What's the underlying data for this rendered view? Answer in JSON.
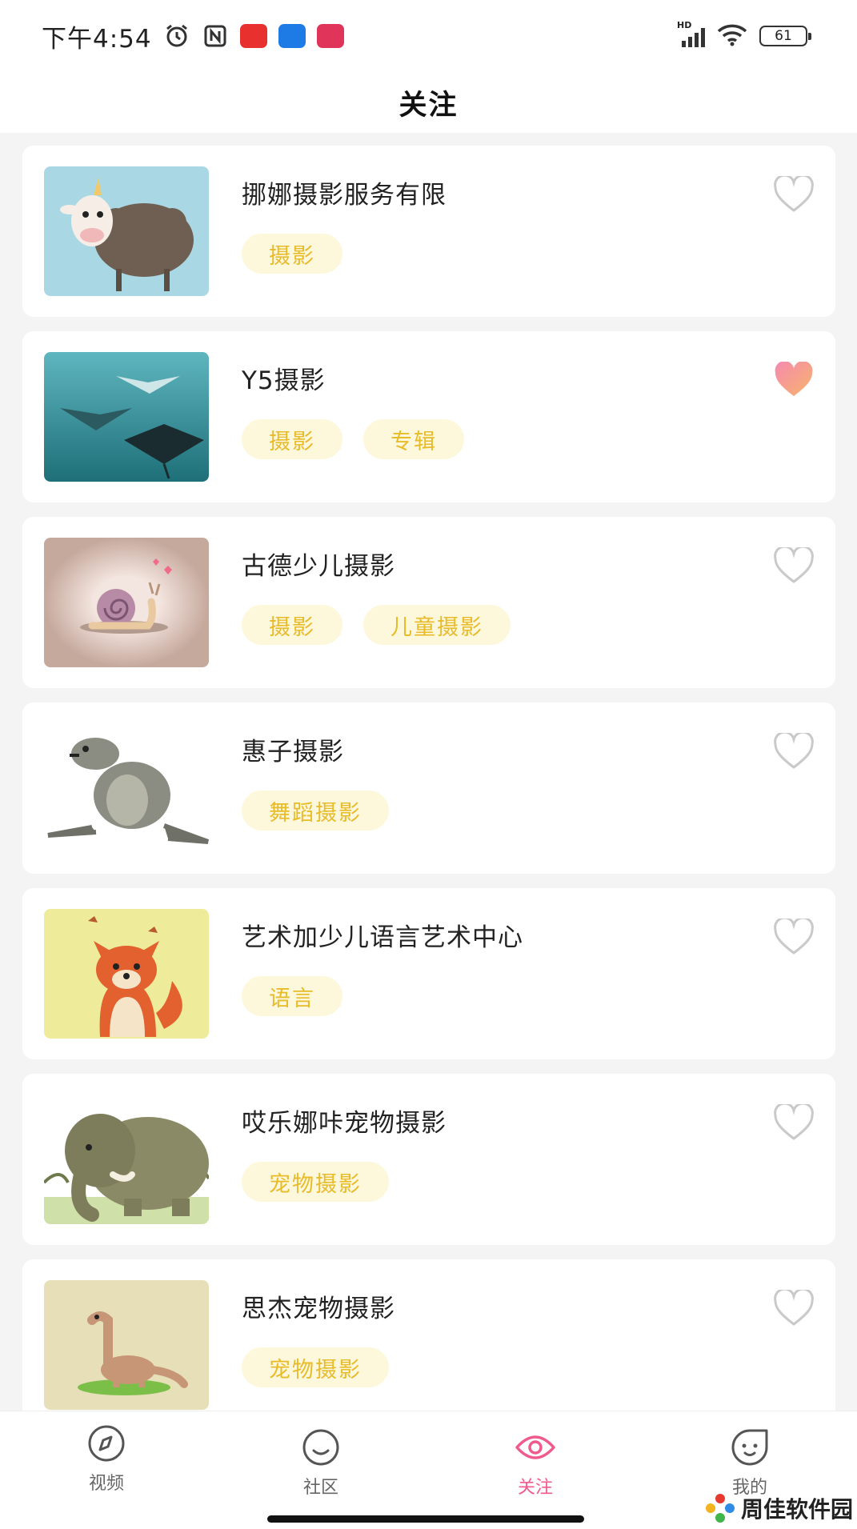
{
  "status": {
    "time": "下午4:54",
    "network": "HD",
    "battery": "61"
  },
  "header": {
    "title": "关注"
  },
  "items": [
    {
      "name": "挪娜摄影服务有限",
      "tags": [
        "摄影"
      ],
      "liked": false,
      "thumb": "sheep"
    },
    {
      "name": "Y5摄影",
      "tags": [
        "摄影",
        "专辑"
      ],
      "liked": true,
      "thumb": "manta-rays"
    },
    {
      "name": "古德少儿摄影",
      "tags": [
        "摄影",
        "儿童摄影"
      ],
      "liked": false,
      "thumb": "snail"
    },
    {
      "name": "惠子摄影",
      "tags": [
        "舞蹈摄影"
      ],
      "liked": false,
      "thumb": "seal"
    },
    {
      "name": "艺术加少儿语言艺术中心",
      "tags": [
        "语言"
      ],
      "liked": false,
      "thumb": "fox"
    },
    {
      "name": "哎乐娜咔宠物摄影",
      "tags": [
        "宠物摄影"
      ],
      "liked": false,
      "thumb": "elephant"
    },
    {
      "name": "思杰宠物摄影",
      "tags": [
        "宠物摄影"
      ],
      "liked": false,
      "thumb": "dinosaur"
    }
  ],
  "tabs": [
    {
      "label": "视频",
      "icon": "compass-icon",
      "active": false
    },
    {
      "label": "社区",
      "icon": "smile-icon",
      "active": false
    },
    {
      "label": "关注",
      "icon": "eye-icon",
      "active": true
    },
    {
      "label": "我的",
      "icon": "face-icon",
      "active": false
    }
  ],
  "watermark": {
    "text": "周佳软件园"
  },
  "colors": {
    "accent": "#f05a8e",
    "tag_bg": "#fdf7dc",
    "tag_text": "#e8bb28"
  }
}
